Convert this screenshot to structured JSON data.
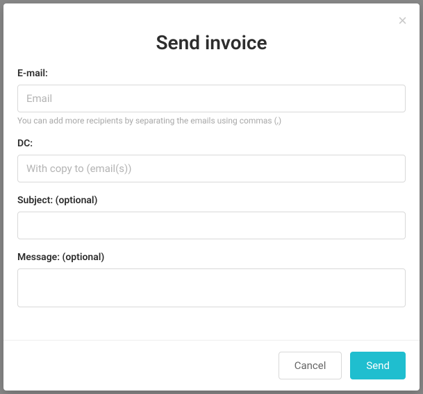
{
  "modal": {
    "title": "Send invoice",
    "close_label": "×"
  },
  "form": {
    "email": {
      "label": "E-mail:",
      "placeholder": "Email",
      "value": "",
      "help": "You can add more recipients by separating the emails using commas (,)"
    },
    "dc": {
      "label": "DC:",
      "placeholder": "With copy to (email(s))",
      "value": ""
    },
    "subject": {
      "label": "Subject: (optional)",
      "placeholder": "",
      "value": ""
    },
    "message": {
      "label": "Message: (optional)",
      "placeholder": "",
      "value": ""
    }
  },
  "footer": {
    "cancel_label": "Cancel",
    "send_label": "Send"
  }
}
